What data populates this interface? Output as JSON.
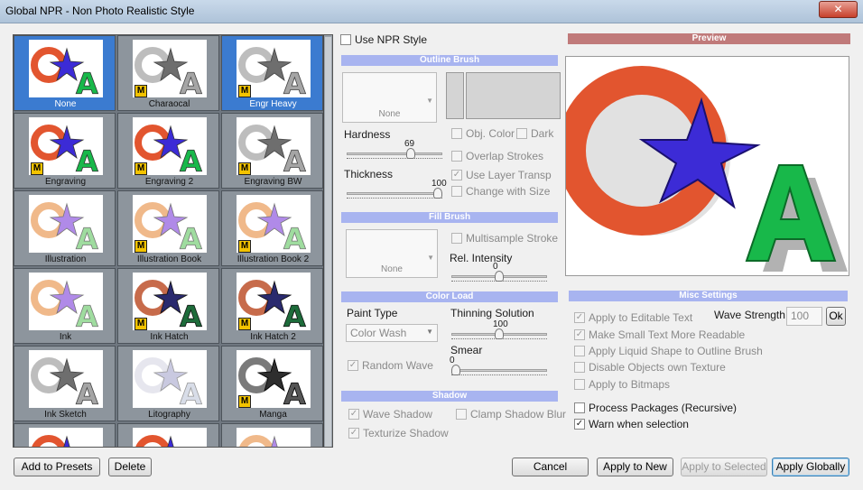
{
  "window": {
    "title": "Global NPR - Non Photo Realistic Style",
    "close_glyph": "✕"
  },
  "presets": [
    {
      "label": "None",
      "m": false,
      "selected": true,
      "style": "color"
    },
    {
      "label": "Charaocal",
      "m": true,
      "selected": false,
      "style": "gray"
    },
    {
      "label": "Engr Heavy",
      "m": true,
      "selected": true,
      "style": "gray"
    },
    {
      "label": "Engraving",
      "m": true,
      "selected": false,
      "style": "color"
    },
    {
      "label": "Engraving 2",
      "m": true,
      "selected": false,
      "style": "color"
    },
    {
      "label": "Engraving BW",
      "m": true,
      "selected": false,
      "style": "gray"
    },
    {
      "label": "Illustration",
      "m": false,
      "selected": false,
      "style": "pastel"
    },
    {
      "label": "Illustration Book",
      "m": true,
      "selected": false,
      "style": "pastel"
    },
    {
      "label": "Illustration Book 2",
      "m": true,
      "selected": false,
      "style": "pastel"
    },
    {
      "label": "Ink",
      "m": false,
      "selected": false,
      "style": "pastel"
    },
    {
      "label": "Ink Hatch",
      "m": true,
      "selected": false,
      "style": "dark"
    },
    {
      "label": "Ink Hatch 2",
      "m": true,
      "selected": false,
      "style": "dark"
    },
    {
      "label": "Ink Sketch",
      "m": false,
      "selected": false,
      "style": "gray"
    },
    {
      "label": "Litography",
      "m": false,
      "selected": false,
      "style": "light"
    },
    {
      "label": "Manga",
      "m": true,
      "selected": false,
      "style": "manga"
    },
    {
      "label": "",
      "m": false,
      "selected": false,
      "style": "color"
    },
    {
      "label": "",
      "m": false,
      "selected": false,
      "style": "color"
    },
    {
      "label": "",
      "m": false,
      "selected": false,
      "style": "pastel"
    }
  ],
  "npr": {
    "use_npr_style": "Use NPR Style"
  },
  "outline": {
    "header": "Outline Brush",
    "brush_caption": "None",
    "hardness_label": "Hardness",
    "hardness_value": "69",
    "hardness_pct": 0.69,
    "thickness_label": "Thickness",
    "thickness_value": "100",
    "thickness_pct": 1.0,
    "obj_color": "Obj. Color",
    "dark": "Dark",
    "overlap": "Overlap Strokes",
    "use_layer_transp": "Use Layer Transp",
    "change_with_size": "Change with Size"
  },
  "fill": {
    "header": "Fill Brush",
    "brush_caption": "None",
    "multisample": "Multisample Stroke",
    "rel_intensity_label": "Rel. Intensity",
    "rel_intensity_value": "0",
    "rel_intensity_pct": 0.5
  },
  "color_load": {
    "header": "Color Load",
    "paint_type_label": "Paint Type",
    "paint_type_value": "Color Wash",
    "random_wave": "Random Wave",
    "thinning_label": "Thinning Solution",
    "thinning_value": "100",
    "thinning_pct": 0.5,
    "smear_label": "Smear",
    "smear_value": "0",
    "smear_pct": 0.0
  },
  "shadow": {
    "header": "Shadow",
    "wave_shadow": "Wave Shadow",
    "clamp_blur": "Clamp Shadow Blur",
    "texturize": "Texturize Shadow"
  },
  "preview": {
    "header": "Preview"
  },
  "misc": {
    "header": "Misc Settings",
    "apply_editable": "Apply to Editable Text",
    "small_text": "Make Small Text More Readable",
    "liquid_shape": "Apply Liquid Shape to Outline Brush",
    "disable_texture": "Disable Objects own Texture",
    "apply_bitmaps": "Apply to Bitmaps",
    "wave_strength_label": "Wave Strength",
    "wave_strength_value": "100",
    "ok_label": "Ok",
    "process_packages": "Process Packages (Recursive)",
    "warn_selection": "Warn when selection"
  },
  "buttons": {
    "add_presets": "Add to Presets",
    "delete": "Delete",
    "cancel": "Cancel",
    "apply_new": "Apply to New",
    "apply_selected": "Apply to Selected",
    "apply_globally": "Apply Globally"
  },
  "colors": {
    "section_header": "#a8b4f0",
    "preview_header": "#c07a7a",
    "ring": "#e2552f",
    "star": "#3c2bd6",
    "letter": "#18b84a"
  }
}
